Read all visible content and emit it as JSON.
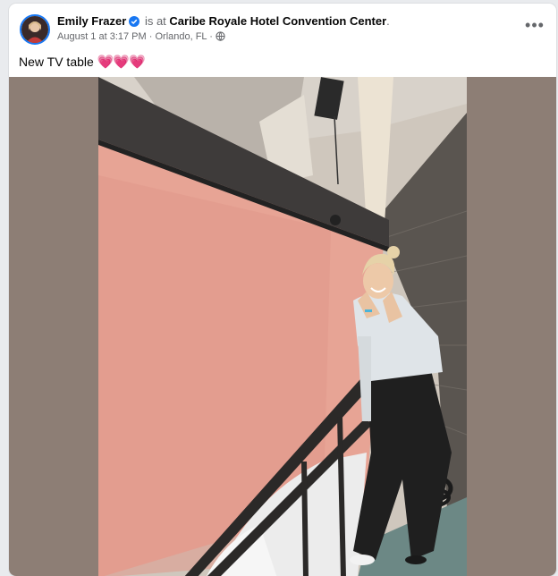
{
  "post": {
    "author": "Emily Frazer",
    "location_prefix": "is at",
    "location": "Caribe Royale Hotel Convention Center",
    "location_suffix": ".",
    "timestamp": "August 1 at 3:17 PM",
    "separator": "·",
    "city": "Orlando, FL",
    "caption_text": "New TV table",
    "caption_emoji": "💗💗💗",
    "more_label": "•••"
  },
  "icons": {
    "verified": "verified-badge-icon",
    "privacy": "globe-icon",
    "more": "more-options-icon"
  },
  "colors": {
    "brand_blue": "#1877f2",
    "backdrop_pink": "#e7a495",
    "photo_frame": "#8d7e75"
  }
}
